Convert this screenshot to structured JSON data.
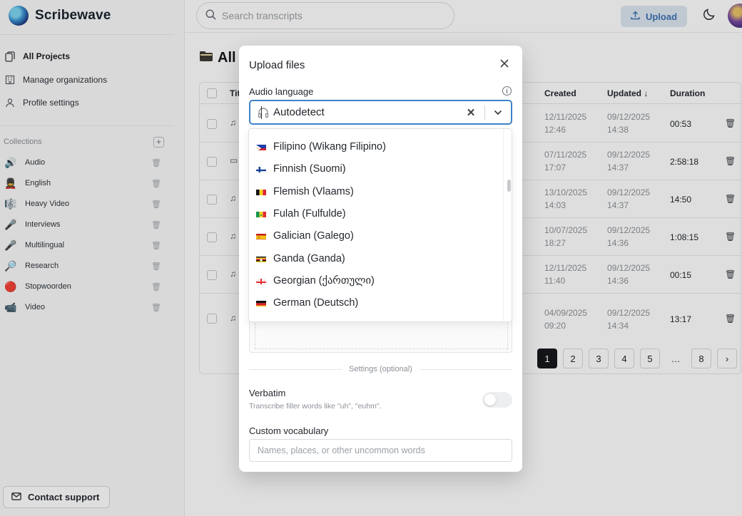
{
  "app": {
    "name": "Scribewave"
  },
  "sidebar": {
    "nav": [
      {
        "label": "All Projects",
        "icon": "files-icon"
      },
      {
        "label": "Manage organizations",
        "icon": "building-icon"
      },
      {
        "label": "Profile settings",
        "icon": "user-icon"
      }
    ],
    "collections_label": "Collections",
    "collections": [
      {
        "label": "Audio",
        "emoji": "🔊"
      },
      {
        "label": "English",
        "emoji": "💂"
      },
      {
        "label": "Heavy Video",
        "emoji": "🎼"
      },
      {
        "label": "Interviews",
        "emoji": "🎤"
      },
      {
        "label": "Multilingual",
        "emoji": "🎤"
      },
      {
        "label": "Research",
        "emoji": "🔎"
      },
      {
        "label": "Stopwoorden",
        "emoji": "🔴"
      },
      {
        "label": "Video",
        "emoji": "📹"
      }
    ],
    "contact_support": "Contact support"
  },
  "topbar": {
    "search_placeholder": "Search transcripts",
    "upload_label": "Upload"
  },
  "page": {
    "title": "All",
    "columns": {
      "title": "Tit",
      "created": "Created",
      "updated": "Updated ↓",
      "duration": "Duration"
    },
    "rows": [
      {
        "created_date": "12/11/2025",
        "created_time": "12:46",
        "updated_date": "09/12/2025",
        "updated_time": "14:38",
        "duration": "00:53",
        "icon": "♫"
      },
      {
        "created_date": "07/11/2025",
        "created_time": "17:07",
        "updated_date": "09/12/2025",
        "updated_time": "14:37",
        "duration": "2:58:18",
        "icon": "▭"
      },
      {
        "created_date": "13/10/2025",
        "created_time": "14:03",
        "updated_date": "09/12/2025",
        "updated_time": "14:37",
        "duration": "14:50",
        "icon": "♫"
      },
      {
        "created_date": "10/07/2025",
        "created_time": "18:27",
        "updated_date": "09/12/2025",
        "updated_time": "14:36",
        "duration": "1:08:15",
        "icon": "♫"
      },
      {
        "created_date": "12/11/2025",
        "created_time": "11:40",
        "updated_date": "09/12/2025",
        "updated_time": "14:36",
        "duration": "00:15",
        "icon": "♫"
      },
      {
        "created_date": "04/09/2025",
        "created_time": "09:20",
        "updated_date": "09/12/2025",
        "updated_time": "14:34",
        "duration": "13:17",
        "icon": "♫"
      }
    ],
    "pagination": [
      "1",
      "2",
      "3",
      "4",
      "5",
      "…",
      "8",
      "›"
    ],
    "current_page": "1"
  },
  "modal": {
    "title": "Upload files",
    "audio_language_label": "Audio language",
    "selected_language": "Autodetect",
    "language_options": [
      {
        "label": "Filipino (Wikang Filipino)",
        "flag": "ph"
      },
      {
        "label": "Finnish (Suomi)",
        "flag": "fi"
      },
      {
        "label": "Flemish (Vlaams)",
        "flag": "be"
      },
      {
        "label": "Fulah (Fulfulde)",
        "flag": "sn"
      },
      {
        "label": "Galician (Galego)",
        "flag": "es"
      },
      {
        "label": "Ganda (Ganda)",
        "flag": "ug"
      },
      {
        "label": "Georgian (ქართული)",
        "flag": "ge"
      },
      {
        "label": "German (Deutsch)",
        "flag": "de"
      }
    ],
    "settings_label": "Settings (optional)",
    "verbatim_label": "Verbatim",
    "verbatim_hint": "Transcribe filler words like \"uh\", \"euhm\".",
    "verbatim_enabled": false,
    "vocab_label": "Custom vocabulary",
    "vocab_placeholder": "Names, places, or other uncommon words",
    "vocab_value": ""
  },
  "colors": {
    "accent": "#3f82c8",
    "upload_bg": "#dde7f2",
    "upload_text": "#3f72b5",
    "pagination_active": "#17191c"
  }
}
